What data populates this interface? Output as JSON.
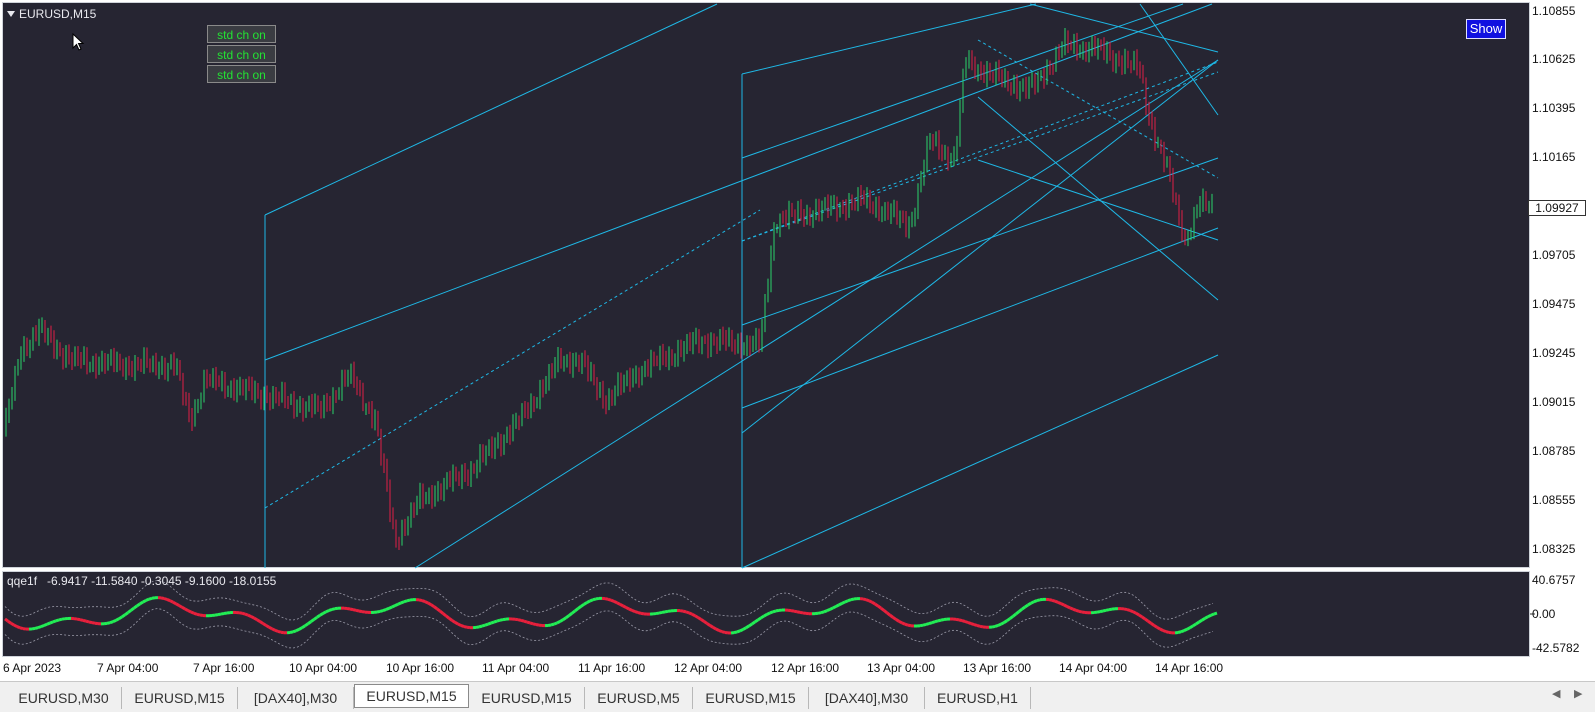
{
  "window": {
    "symbol_title": "EURUSD,M15"
  },
  "buttons": {
    "std_channel_labels": [
      "std ch on",
      "std ch on",
      "std ch on"
    ],
    "show_label": "Show"
  },
  "price_scale": {
    "labels": [
      "1.10855",
      "1.10625",
      "1.10395",
      "1.10165",
      "1.09705",
      "1.09475",
      "1.09245",
      "1.09015",
      "1.08785",
      "1.08555",
      "1.08325"
    ],
    "current_price": "1.09927"
  },
  "indicator": {
    "title": "qqe1f",
    "values": "-6.9417 -11.5840 -0.3045 -9.1600 -18.0155",
    "scale_labels": [
      "40.6757",
      "0.00",
      "-42.5782"
    ]
  },
  "time_axis": {
    "labels": [
      "6 Apr 2023",
      "7 Apr 04:00",
      "7 Apr 16:00",
      "10 Apr 04:00",
      "10 Apr 16:00",
      "11 Apr 04:00",
      "11 Apr 16:00",
      "12 Apr 04:00",
      "12 Apr 16:00",
      "13 Apr 04:00",
      "13 Apr 16:00",
      "14 Apr 04:00",
      "14 Apr 16:00"
    ]
  },
  "tabs": [
    {
      "label": "EURUSD,M30",
      "active": false
    },
    {
      "label": "EURUSD,M15",
      "active": false
    },
    {
      "label": "[DAX40],M30",
      "active": false
    },
    {
      "label": "EURUSD,M15",
      "active": true
    },
    {
      "label": "EURUSD,M15",
      "active": false
    },
    {
      "label": "EURUSD,M5",
      "active": false
    },
    {
      "label": "EURUSD,M15",
      "active": false
    },
    {
      "label": "[DAX40],M30",
      "active": false
    },
    {
      "label": "EURUSD,H1",
      "active": false
    }
  ],
  "colors": {
    "background": "#262532",
    "channel_lines": "#1fb8e6",
    "bull_candle": "#2bd46a",
    "bear_candle": "#e02045",
    "qqe_up": "#22ee55",
    "qqe_down": "#e8203c"
  },
  "icons": {
    "tab_prev": "chevron-left-icon",
    "tab_next": "chevron-right-icon",
    "collapse": "triangle-down-icon",
    "cursor": "mouse-pointer-icon"
  }
}
